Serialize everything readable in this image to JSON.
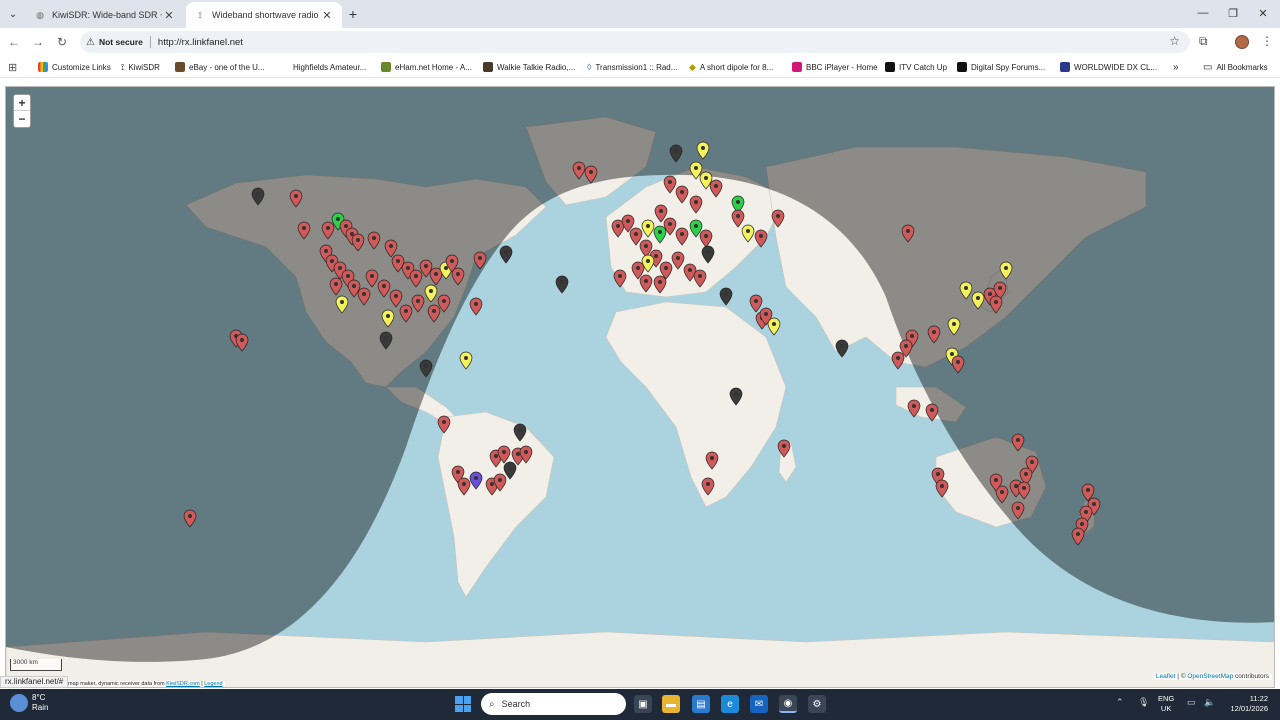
{
  "tabs": [
    {
      "title": "KiwiSDR: Wide-band SDR + GP",
      "active": false
    },
    {
      "title": "Wideband shortwave radio rece",
      "active": true
    }
  ],
  "address": {
    "security_label": "Not secure",
    "url": "http://rx.linkfanel.net"
  },
  "bookmarks": [
    "Customize Links",
    "KiwiSDR",
    "eBay - one of the U...",
    "Highfields Amateur...",
    "eHam.net Home - A...",
    "Walkie Talkie Radio,...",
    "Transmission1 :: Rad...",
    "A short dipole for 8...",
    "BBC iPlayer - Home",
    "ITV Catch Up",
    "Digital Spy Forums...",
    "WORLDWIDE DX CL...",
    "All Bookmarks"
  ],
  "map": {
    "zoom_in": "+",
    "zoom_out": "−",
    "scale_km": "3000 km",
    "attribution_leaflet": "Leaflet",
    "attribution_sep": "| ©",
    "attribution_osm": "OpenStreetMap",
    "attribution_contrib": "contributors",
    "note_prefix": "map maker, dynamic receiver data from",
    "note_link1": "KiwiSDR.com",
    "note_sep": "|",
    "note_link2": "Legend",
    "colors": {
      "ocean": "#aad3df",
      "land": "#f2efe9",
      "night": "#000000",
      "marker_red": "#d05a5a",
      "marker_yellow": "#f4f25c",
      "marker_dark": "#3a3a3a",
      "marker_green": "#2ed04a",
      "marker_purple": "#6a4fd8"
    }
  },
  "status_url": "rx.linkfanel.net/#",
  "taskbar": {
    "temperature": "8°C",
    "weather": "Rain",
    "search_placeholder": "Search",
    "lang_line1": "ENG",
    "lang_line2": "UK",
    "time": "11:22",
    "date": "12/01/2026"
  }
}
